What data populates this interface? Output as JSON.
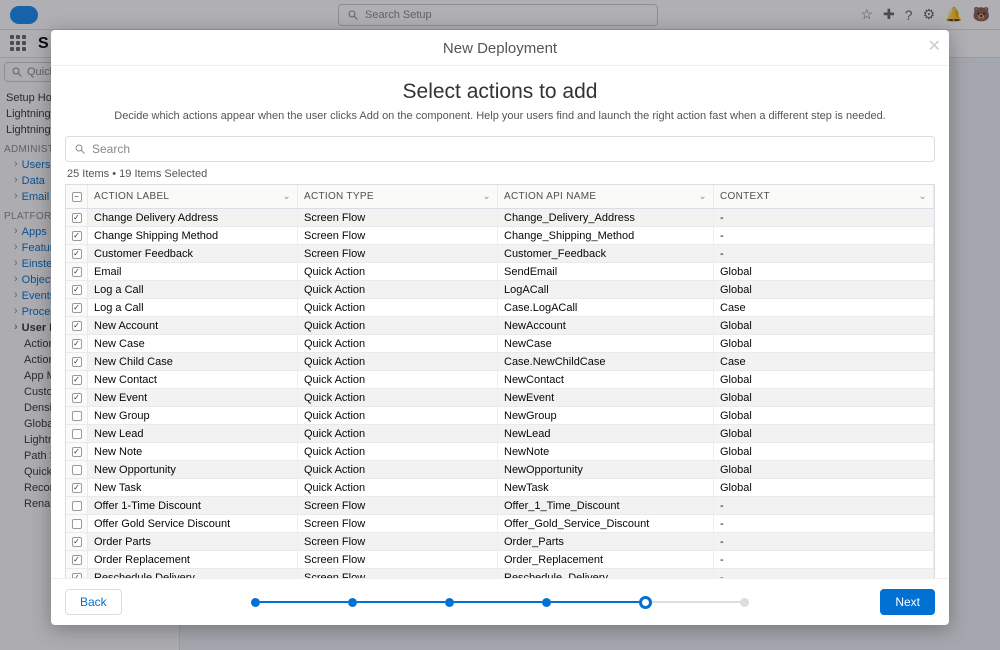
{
  "header": {
    "search_placeholder": "Search Setup",
    "app_letter": "S"
  },
  "sidebar": {
    "quick_placeholder": "Quick",
    "links_top": [
      "Setup Home",
      "Lightning Experience Transition Assistant",
      "Lightning Usage"
    ],
    "admin_label": "ADMINISTRATION",
    "admin_items": [
      "Users",
      "Data",
      "Email"
    ],
    "platform_label": "PLATFORM TOOLS",
    "platform_items": [
      "Apps",
      "Feature Settings",
      "Einstein",
      "Objects and Fields",
      "Events",
      "Process Automation"
    ],
    "ui_parent": "User Interface",
    "ui_children": [
      "Action Link Templates",
      "Actions & Recommendations",
      "App Menu",
      "Custom Labels",
      "Density Settings",
      "Global Actions",
      "Lightning App Builder",
      "Path Settings",
      "Quick Text Settings",
      "Record Page Settings",
      "Rename Tabs and Labels"
    ]
  },
  "modal": {
    "title": "New Deployment",
    "heading": "Select actions to add",
    "subtitle": "Decide which actions appear when the user clicks Add on the component. Help your users find and launch the right action fast when a different step is needed.",
    "search_placeholder": "Search",
    "count_text": "25 Items • 19 Items Selected",
    "columns": {
      "label": "Action Label",
      "type": "Action Type",
      "api": "Action API Name",
      "ctx": "Context"
    },
    "rows": [
      {
        "c": true,
        "label": "Change Delivery Address",
        "type": "Screen Flow",
        "api": "Change_Delivery_Address",
        "ctx": "-"
      },
      {
        "c": true,
        "label": "Change Shipping Method",
        "type": "Screen Flow",
        "api": "Change_Shipping_Method",
        "ctx": "-"
      },
      {
        "c": true,
        "label": "Customer Feedback",
        "type": "Screen Flow",
        "api": "Customer_Feedback",
        "ctx": "-"
      },
      {
        "c": true,
        "label": "Email",
        "type": "Quick Action",
        "api": "SendEmail",
        "ctx": "Global"
      },
      {
        "c": true,
        "label": "Log a Call",
        "type": "Quick Action",
        "api": "LogACall",
        "ctx": "Global"
      },
      {
        "c": true,
        "label": "Log a Call",
        "type": "Quick Action",
        "api": "Case.LogACall",
        "ctx": "Case"
      },
      {
        "c": true,
        "label": "New Account",
        "type": "Quick Action",
        "api": "NewAccount",
        "ctx": "Global"
      },
      {
        "c": true,
        "label": "New Case",
        "type": "Quick Action",
        "api": "NewCase",
        "ctx": "Global"
      },
      {
        "c": true,
        "label": "New Child Case",
        "type": "Quick Action",
        "api": "Case.NewChildCase",
        "ctx": "Case"
      },
      {
        "c": true,
        "label": "New Contact",
        "type": "Quick Action",
        "api": "NewContact",
        "ctx": "Global"
      },
      {
        "c": true,
        "label": "New Event",
        "type": "Quick Action",
        "api": "NewEvent",
        "ctx": "Global"
      },
      {
        "c": false,
        "label": "New Group",
        "type": "Quick Action",
        "api": "NewGroup",
        "ctx": "Global"
      },
      {
        "c": false,
        "label": "New Lead",
        "type": "Quick Action",
        "api": "NewLead",
        "ctx": "Global"
      },
      {
        "c": true,
        "label": "New Note",
        "type": "Quick Action",
        "api": "NewNote",
        "ctx": "Global"
      },
      {
        "c": false,
        "label": "New Opportunity",
        "type": "Quick Action",
        "api": "NewOpportunity",
        "ctx": "Global"
      },
      {
        "c": true,
        "label": "New Task",
        "type": "Quick Action",
        "api": "NewTask",
        "ctx": "Global"
      },
      {
        "c": false,
        "label": "Offer 1-Time Discount",
        "type": "Screen Flow",
        "api": "Offer_1_Time_Discount",
        "ctx": "-"
      },
      {
        "c": false,
        "label": "Offer Gold Service Discount",
        "type": "Screen Flow",
        "api": "Offer_Gold_Service_Discount",
        "ctx": "-"
      },
      {
        "c": true,
        "label": "Order Parts",
        "type": "Screen Flow",
        "api": "Order_Parts",
        "ctx": "-"
      },
      {
        "c": true,
        "label": "Order Replacement",
        "type": "Screen Flow",
        "api": "Order_Replacement",
        "ctx": "-"
      },
      {
        "c": true,
        "label": "Reschedule Delivery",
        "type": "Screen Flow",
        "api": "Reschedule_Delivery",
        "ctx": "-"
      }
    ],
    "back": "Back",
    "next": "Next"
  }
}
